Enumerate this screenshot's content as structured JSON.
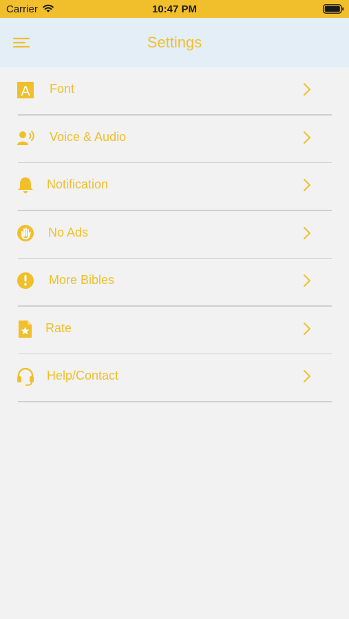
{
  "status_bar": {
    "carrier": "Carrier",
    "time": "10:47 PM"
  },
  "nav": {
    "title": "Settings",
    "menu_icon": "hamburger-menu-icon"
  },
  "colors": {
    "accent": "#f0bf2b",
    "status_bar": "#f0bf2b",
    "nav_bar": "#e4eef6",
    "background": "#f2f2f2",
    "divider": "#cfcfcf"
  },
  "settings": {
    "items": [
      {
        "label": "Font",
        "icon": "font-letter-a-icon"
      },
      {
        "label": "Voice & Audio",
        "icon": "voice-speaker-icon"
      },
      {
        "label": "Notification",
        "icon": "bell-icon"
      },
      {
        "label": "No Ads",
        "icon": "hand-stop-icon"
      },
      {
        "label": "More Bibles",
        "icon": "info-circle-icon"
      },
      {
        "label": "Rate",
        "icon": "star-document-icon"
      },
      {
        "label": "Help/Contact",
        "icon": "headset-icon"
      }
    ]
  }
}
